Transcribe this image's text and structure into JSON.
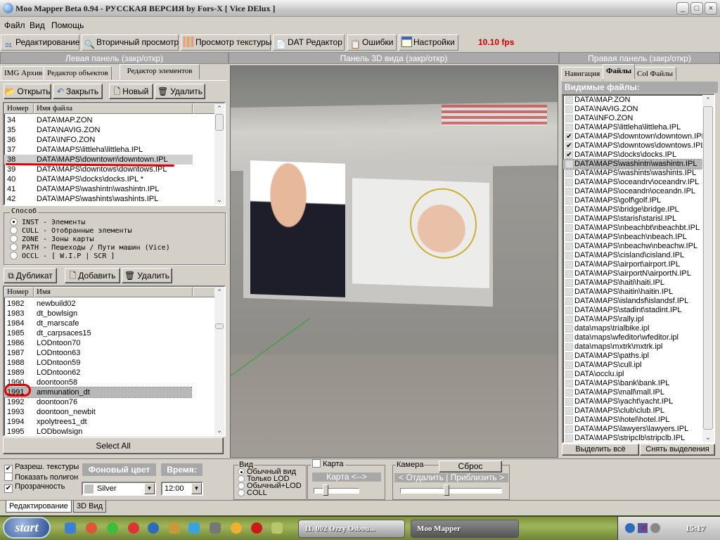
{
  "window": {
    "title": "Moo Mapper Beta 0.94 - РУССКАЯ ВЕРСИЯ by Fors-X [ Vice DElux ]"
  },
  "menu": [
    "Файл",
    "Вид",
    "Помощь"
  ],
  "toolbar": {
    "buttons": [
      "Редактирование",
      "Вторичный просмотр",
      "Просмотр текстуры",
      "DAT Редактор",
      "Ошибки",
      "Настройки"
    ],
    "fps": "10.10 fps",
    "fps_color": "#d00000"
  },
  "panels": {
    "left": "Левая панель (закр/откр)",
    "center": "Панель 3D вида (закр/откр)",
    "right": "Правая панель (закр/откр)"
  },
  "left": {
    "tabs": [
      "IMG Архив",
      "Редактор объектов",
      "Редактор элементов"
    ],
    "active_tab": 2,
    "file_buttons": [
      "Открыть",
      "Закрыть",
      "Новый",
      "Удалить"
    ],
    "file_columns": [
      "Номер",
      "Имя файла"
    ],
    "files": [
      {
        "n": "34",
        "v": "DATA\\MAP.ZON"
      },
      {
        "n": "35",
        "v": "DATA\\NAVIG.ZON"
      },
      {
        "n": "36",
        "v": "DATA\\INFO.ZON"
      },
      {
        "n": "37",
        "v": "DATA\\MAPS\\littleha\\littleha.IPL"
      },
      {
        "n": "38",
        "v": "DATA\\MAPS\\downtown\\downtown.IPL"
      },
      {
        "n": "39",
        "v": "DATA\\MAPS\\downtows\\downtows.IPL"
      },
      {
        "n": "40",
        "v": "DATA\\MAPS\\docks\\docks.IPL *"
      },
      {
        "n": "41",
        "v": "DATA\\MAPS\\washintn\\washintn.IPL"
      },
      {
        "n": "42",
        "v": "DATA\\MAPS\\washints\\washints.IPL"
      }
    ],
    "selected_file": "38",
    "mode_label": "Способ",
    "modes": [
      "INST - Элементы",
      "CULL - Отобранные элементы",
      "ZONE - Зоны карты",
      "PATH - Пешеходы / Пути машин (Vice)",
      "OCCL - [ W.I.P | SCR ]"
    ],
    "selected_mode": 0,
    "element_buttons": [
      "Дубликат",
      "Добавить",
      "Удалить"
    ],
    "element_columns": [
      "Номер",
      "Имя"
    ],
    "elements": [
      {
        "n": "1982",
        "v": "newbuild02"
      },
      {
        "n": "1983",
        "v": "dt_bowlsign"
      },
      {
        "n": "1984",
        "v": "dt_marscafe"
      },
      {
        "n": "1985",
        "v": "dt_carpsaces15"
      },
      {
        "n": "1986",
        "v": "LODntoon70"
      },
      {
        "n": "1987",
        "v": "LODntoon63"
      },
      {
        "n": "1988",
        "v": "LODntoon59"
      },
      {
        "n": "1989",
        "v": "LODntoon62"
      },
      {
        "n": "1990",
        "v": "doontoon58"
      },
      {
        "n": "1991",
        "v": "ammunation_dt"
      },
      {
        "n": "1992",
        "v": "doontoon76"
      },
      {
        "n": "1993",
        "v": "doontoon_newbit"
      },
      {
        "n": "1994",
        "v": "xpolytrees1_dt"
      },
      {
        "n": "1995",
        "v": "LODbowlsign"
      }
    ],
    "selected_element": "1991",
    "select_all": "Select All"
  },
  "right": {
    "tabs": [
      "Навигация",
      "Файлы",
      "Col Файлы"
    ],
    "active_tab": 1,
    "header": "Видимые файлы:",
    "files": [
      {
        "v": "DATA\\MAP.ZON",
        "c": false
      },
      {
        "v": "DATA\\NAVIG.ZON",
        "c": false
      },
      {
        "v": "DATA\\INFO.ZON",
        "c": false
      },
      {
        "v": "DATA\\MAPS\\littleha\\littleha.IPL",
        "c": false
      },
      {
        "v": "DATA\\MAPS\\downtown\\downtown.IPL",
        "c": true
      },
      {
        "v": "DATA\\MAPS\\downtows\\downtows.IPL",
        "c": true
      },
      {
        "v": "DATA\\MAPS\\docks\\docks.IPL",
        "c": true
      },
      {
        "v": "DATA\\MAPS\\washintn\\washintn.IPL",
        "c": false
      },
      {
        "v": "DATA\\MAPS\\washints\\washints.IPL",
        "c": false
      },
      {
        "v": "DATA\\MAPS\\oceandrv\\oceandrv.IPL",
        "c": false
      },
      {
        "v": "DATA\\MAPS\\oceandn\\oceandn.IPL",
        "c": false
      },
      {
        "v": "DATA\\MAPS\\golf\\golf.IPL",
        "c": false
      },
      {
        "v": "DATA\\MAPS\\bridge\\bridge.IPL",
        "c": false
      },
      {
        "v": "DATA\\MAPS\\starisl\\starisl.IPL",
        "c": false
      },
      {
        "v": "DATA\\MAPS\\nbeachbt\\nbeachbt.IPL",
        "c": false
      },
      {
        "v": "DATA\\MAPS\\nbeach\\nbeach.IPL",
        "c": false
      },
      {
        "v": "DATA\\MAPS\\nbeachw\\nbeachw.IPL",
        "c": false
      },
      {
        "v": "DATA\\MAPS\\cisland\\cisland.IPL",
        "c": false
      },
      {
        "v": "DATA\\MAPS\\airport\\airport.IPL",
        "c": false
      },
      {
        "v": "DATA\\MAPS\\airportN\\airportN.IPL",
        "c": false
      },
      {
        "v": "DATA\\MAPS\\haiti\\haiti.IPL",
        "c": false
      },
      {
        "v": "DATA\\MAPS\\haitin\\haitin.IPL",
        "c": false
      },
      {
        "v": "DATA\\MAPS\\islandsf\\islandsf.IPL",
        "c": false
      },
      {
        "v": "DATA\\MAPS\\stadint\\stadint.IPL",
        "c": false
      },
      {
        "v": "DATA\\MAPS\\rally.ipl",
        "c": false
      },
      {
        "v": "data\\maps\\trialbike.ipl",
        "c": false
      },
      {
        "v": "data\\maps\\wfeditor\\wfeditor.ipl",
        "c": false
      },
      {
        "v": "data\\maps\\mxtrk\\mxtrk.ipl",
        "c": false
      },
      {
        "v": "DATA\\MAPS\\paths.ipl",
        "c": false
      },
      {
        "v": "DATA\\MAPS\\cull.ipl",
        "c": false
      },
      {
        "v": "DATA\\occlu.ipl",
        "c": false
      },
      {
        "v": "DATA\\MAPS\\bank\\bank.IPL",
        "c": false
      },
      {
        "v": "DATA\\MAPS\\mall\\mall.IPL",
        "c": false
      },
      {
        "v": "DATA\\MAPS\\yacht\\yacht.IPL",
        "c": false
      },
      {
        "v": "DATA\\MAPS\\club\\club.IPL",
        "c": false
      },
      {
        "v": "DATA\\MAPS\\hotel\\hotel.IPL",
        "c": false
      },
      {
        "v": "DATA\\MAPS\\lawyers\\lawyers.IPL",
        "c": false
      },
      {
        "v": "DATA\\MAPS\\stripclb\\stripclb.IPL",
        "c": false
      }
    ],
    "selected_index": 7,
    "select_all": "Выделить всё",
    "deselect": "Снять выделения"
  },
  "bottom": {
    "checks": [
      {
        "label": "Разреш. текстуры",
        "checked": true
      },
      {
        "label": "Показать полигон",
        "checked": false
      },
      {
        "label": "Прозрачность",
        "checked": true
      }
    ],
    "bg_color_label": "Фоновый цвет",
    "bg_color_value": "Silver",
    "time_label": "Время:",
    "time_value": "12:00",
    "view_label": "Вид",
    "view_options": [
      "Обычный вид",
      "Только LOD",
      "Обычный+LOD",
      "COLL"
    ],
    "view_selected": 0,
    "map_check": "Карта",
    "map_check_checked": false,
    "map_slider_label": "Карта <-->",
    "map_slider_value": 0.25,
    "camera_label": "Камера",
    "camera_reset": "Сброс",
    "camera_slider_label": "< Отдалить | Приблизить >",
    "camera_slider_value": 0.45,
    "tabs": [
      "Редактирование",
      "3D Вид"
    ],
    "active_tab": 0
  },
  "taskbar": {
    "start": "start",
    "tasks": [
      "11. 002 Ozzy Osbou...",
      "Moo Mapper"
    ],
    "clock": "15:17"
  }
}
